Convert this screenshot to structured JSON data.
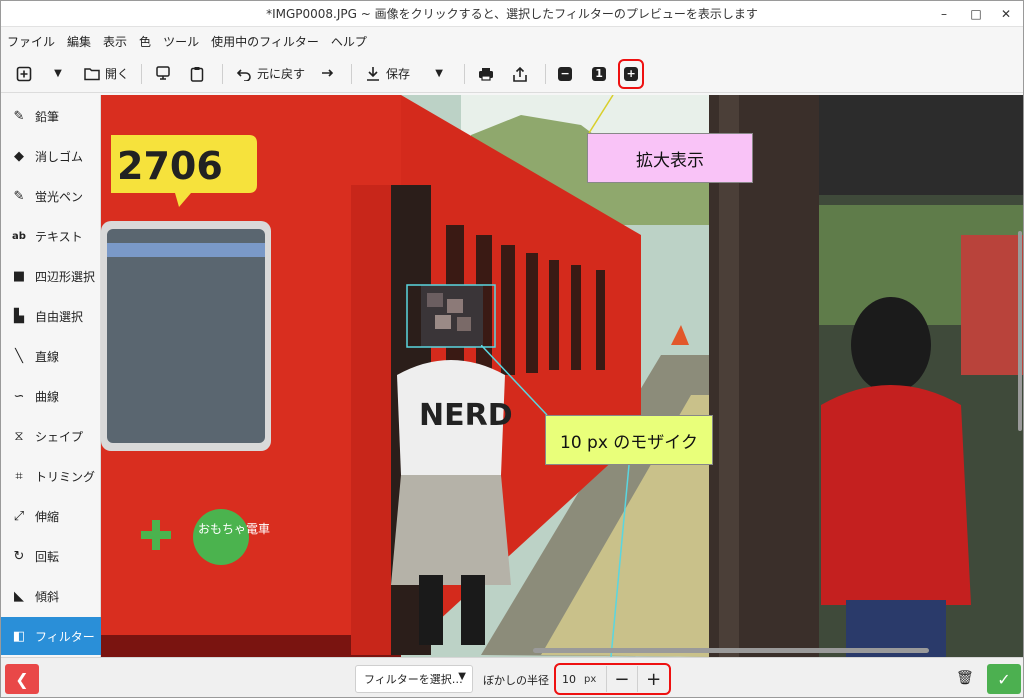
{
  "window": {
    "title": "*IMGP0008.JPG ~ 画像をクリックすると、選択したフィルターのプレビューを表示します",
    "controls": {
      "minimize": "–",
      "maximize": "□",
      "close": "✕"
    }
  },
  "menu": [
    "ファイル",
    "編集",
    "表示",
    "色",
    "ツール",
    "使用中のフィルター",
    "ヘルプ"
  ],
  "toolbar": {
    "new_icon": "plus-square-icon",
    "open_label": "開く",
    "undo_label": "元に戻す",
    "save_label": "保存",
    "zoom_original": "1"
  },
  "sidebar": {
    "items": [
      {
        "label": "鉛筆",
        "icon": "pencil-icon",
        "glyph": "✎"
      },
      {
        "label": "消しゴム",
        "icon": "eraser-icon",
        "glyph": "◆"
      },
      {
        "label": "蛍光ペン",
        "icon": "highlighter-icon",
        "glyph": "✎"
      },
      {
        "label": "テキスト",
        "icon": "text-icon",
        "glyph": "ab"
      },
      {
        "label": "四辺形選択",
        "icon": "rect-select-icon",
        "glyph": "■"
      },
      {
        "label": "自由選択",
        "icon": "free-select-icon",
        "glyph": "▙"
      },
      {
        "label": "直線",
        "icon": "line-icon",
        "glyph": "╲"
      },
      {
        "label": "曲線",
        "icon": "curve-icon",
        "glyph": "∽"
      },
      {
        "label": "シェイプ",
        "icon": "shape-icon",
        "glyph": "⧖"
      },
      {
        "label": "トリミング",
        "icon": "crop-icon",
        "glyph": "⌗"
      },
      {
        "label": "伸縮",
        "icon": "scale-icon",
        "glyph": "⤢"
      },
      {
        "label": "回転",
        "icon": "rotate-icon",
        "glyph": "↻"
      },
      {
        "label": "傾斜",
        "icon": "skew-icon",
        "glyph": "◣"
      },
      {
        "label": "フィルター",
        "icon": "filter-icon",
        "glyph": "◧"
      }
    ]
  },
  "canvas": {
    "train_number": "2706",
    "shirt_text": "NERD",
    "logo_text": "おもちゃ電車"
  },
  "callouts": {
    "zoom": "拡大表示",
    "mosaic": "10 px のモザイク"
  },
  "bottom": {
    "filter_select": "フィルターを選択…",
    "radius_label": "ぼかしの半径",
    "radius_value": "10",
    "radius_unit": "px",
    "minus": "−",
    "plus": "+"
  },
  "colors": {
    "accent": "#2a8fd8",
    "highlight_red": "#e11111",
    "callout_pink": "#f9c3f7",
    "callout_green": "#e9ff7a",
    "train_red": "#d42a1c"
  }
}
